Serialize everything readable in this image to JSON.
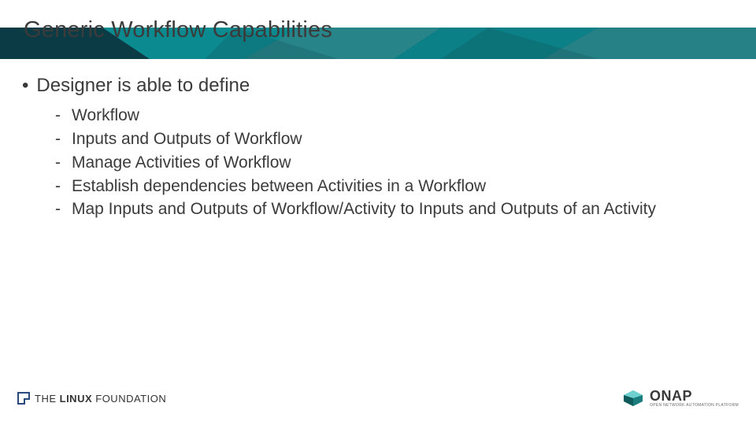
{
  "header": {
    "title": "Generic Workflow Capabilities"
  },
  "body": {
    "bullet_l1": "Designer is able to define",
    "sub_items": [
      "Workflow",
      "Inputs and Outputs of Workflow",
      "Manage Activities of Workflow",
      "Establish dependencies between Activities in a Workflow",
      "Map Inputs and Outputs of Workflow/Activity to Inputs and Outputs of an Activity"
    ]
  },
  "footer": {
    "lf_the": "THE",
    "lf_linux": "LINUX",
    "lf_foundation": "FOUNDATION",
    "onap_main": "ONAP",
    "onap_sub": "OPEN NETWORK AUTOMATION PLATFORM"
  },
  "colors": {
    "band_dark": "#0f4a54",
    "band_teal": "#0b8a8f",
    "band_cyan": "#3cb7b7"
  }
}
